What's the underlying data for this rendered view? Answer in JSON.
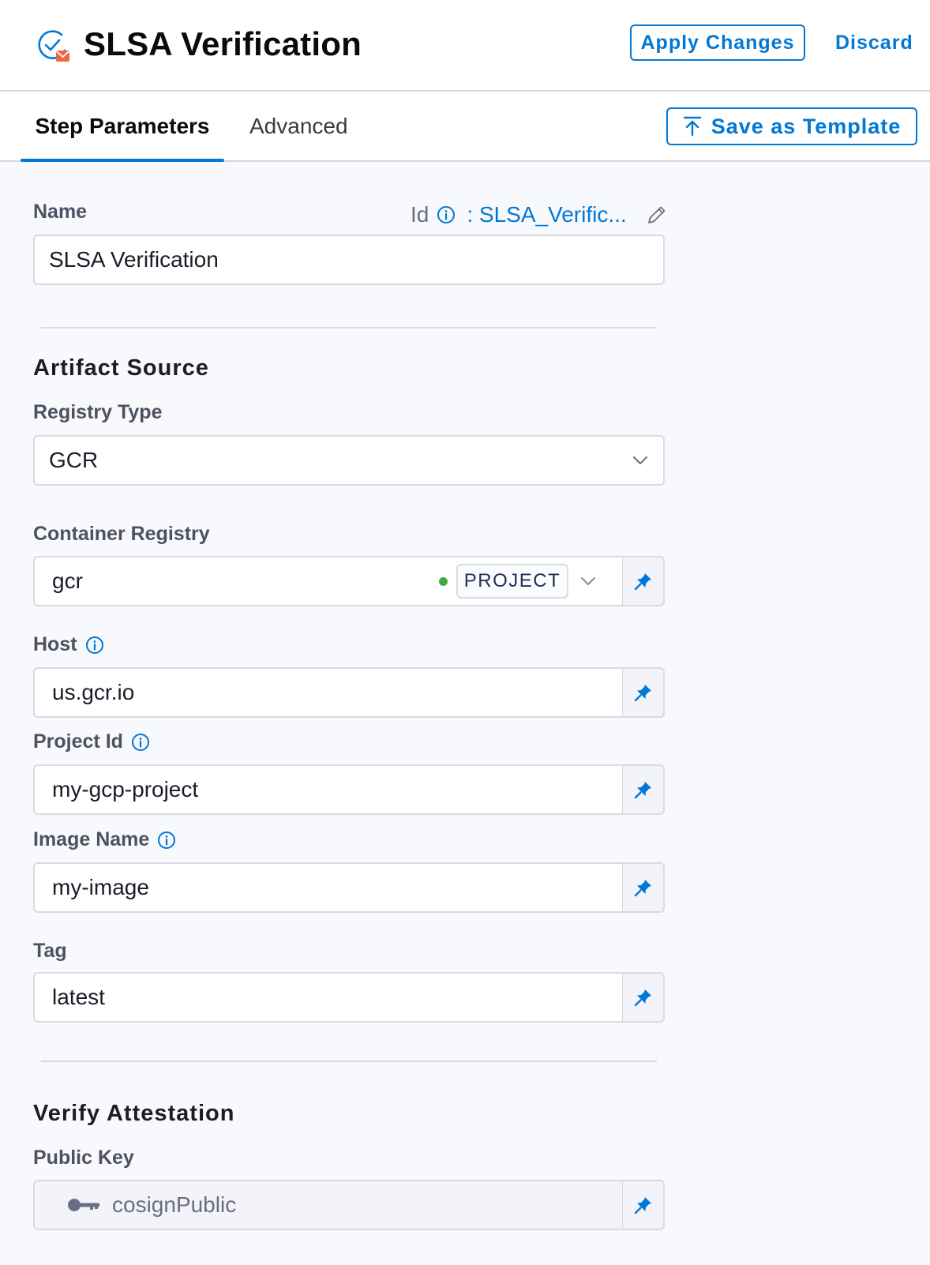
{
  "header": {
    "title": "SLSA Verification",
    "icon": "slsa-verification-icon",
    "apply_label": "Apply Changes",
    "discard_label": "Discard"
  },
  "tabs": [
    {
      "label": "Step Parameters",
      "active": true
    },
    {
      "label": "Advanced",
      "active": false
    }
  ],
  "save_template_label": "Save as Template",
  "name_field": {
    "label": "Name",
    "value": "SLSA Verification",
    "id_label": "Id",
    "id_value": ": SLSA_Verific..."
  },
  "artifact_source": {
    "title": "Artifact Source",
    "registry_type": {
      "label": "Registry Type",
      "value": "GCR"
    },
    "container_registry": {
      "label": "Container Registry",
      "value": "gcr",
      "scope": "PROJECT"
    },
    "host": {
      "label": "Host",
      "value": "us.gcr.io"
    },
    "project_id": {
      "label": "Project Id",
      "value": "my-gcp-project"
    },
    "image_name": {
      "label": "Image Name",
      "value": "my-image"
    },
    "tag": {
      "label": "Tag",
      "value": "latest"
    }
  },
  "verify_attestation": {
    "title": "Verify Attestation",
    "public_key": {
      "label": "Public Key",
      "value": "cosignPublic"
    }
  },
  "colors": {
    "accent": "#0278d5",
    "connected": "#42ab45"
  }
}
